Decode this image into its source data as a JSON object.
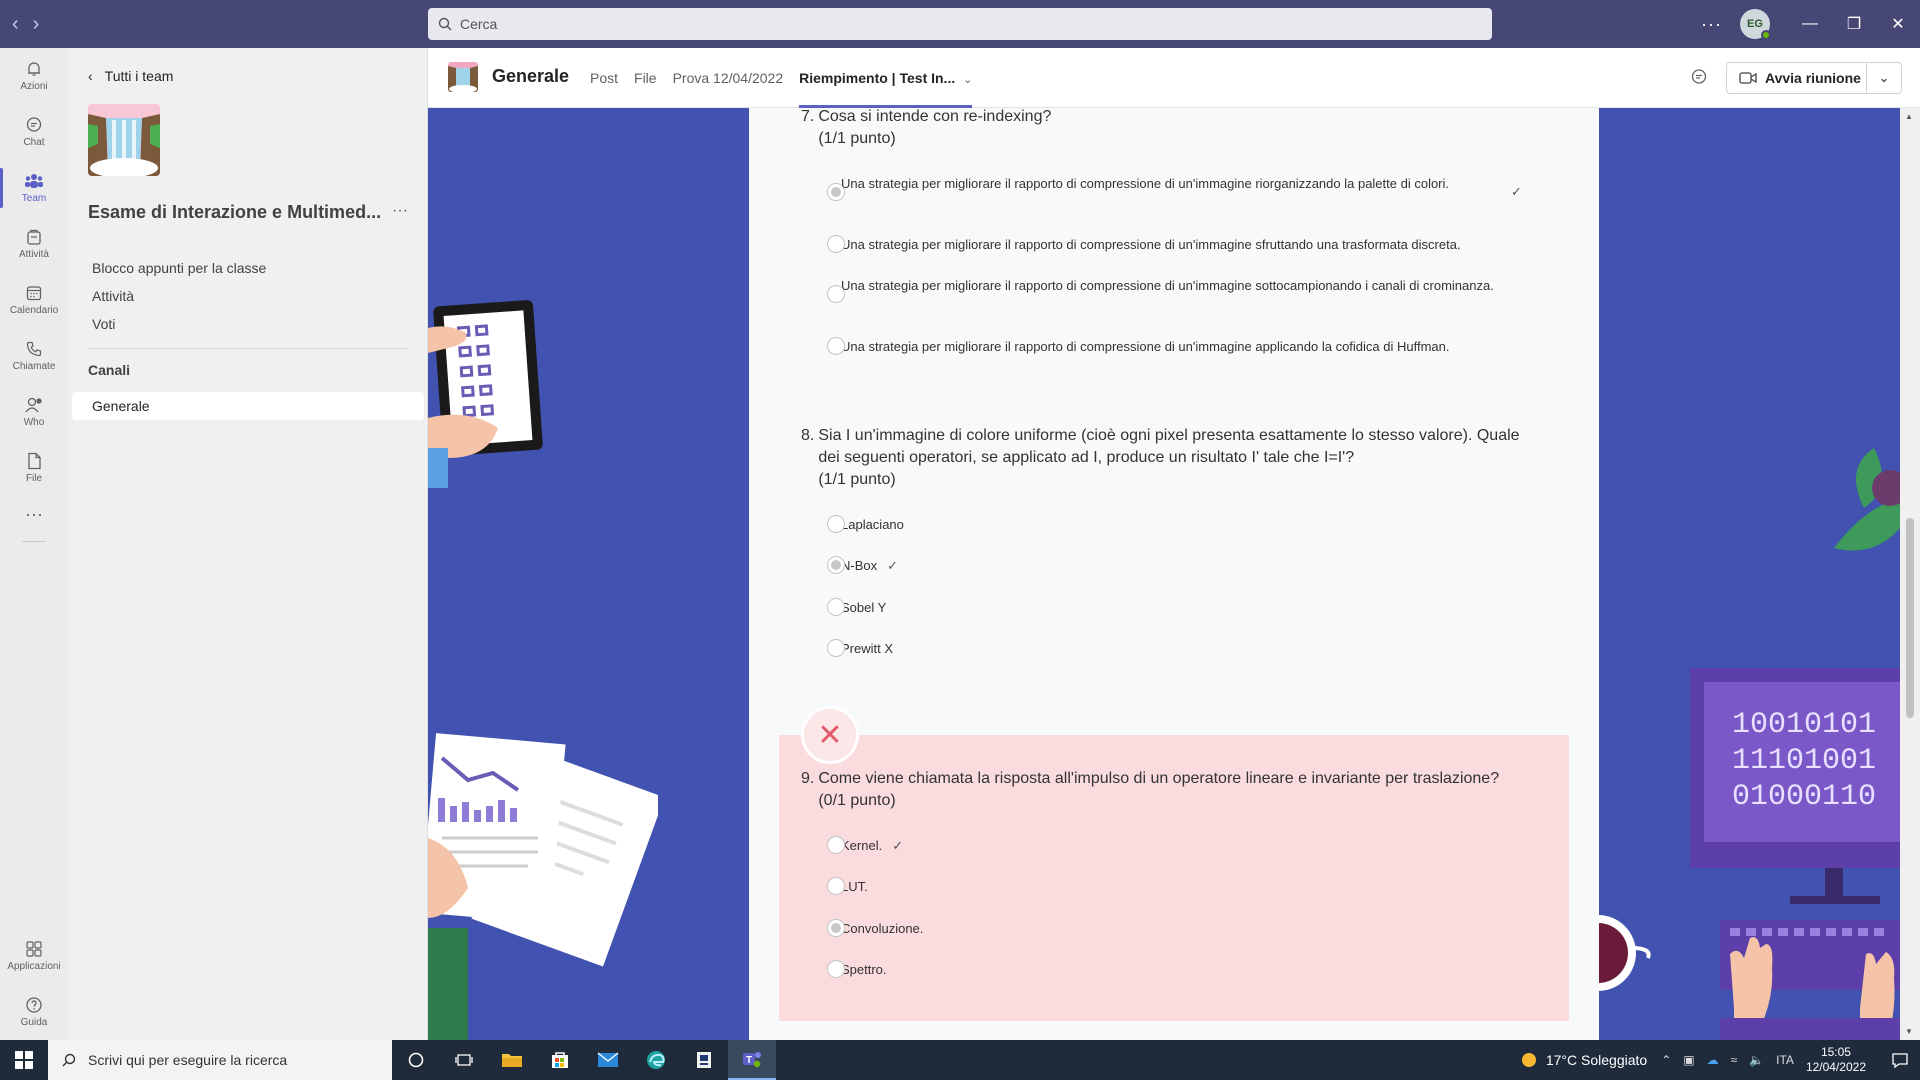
{
  "titlebar": {
    "search_placeholder": "Cerca",
    "more": "···",
    "avatar_initials": "EG"
  },
  "rail": {
    "items": [
      {
        "label": "Azioni",
        "icon": "bell-icon"
      },
      {
        "label": "Chat",
        "icon": "chat-icon"
      },
      {
        "label": "Team",
        "icon": "team-icon",
        "active": true
      },
      {
        "label": "Attività",
        "icon": "assignments-icon"
      },
      {
        "label": "Calendario",
        "icon": "calendar-icon"
      },
      {
        "label": "Chiamate",
        "icon": "phone-icon"
      },
      {
        "label": "Who",
        "icon": "who-icon"
      },
      {
        "label": "File",
        "icon": "file-icon"
      }
    ],
    "more": "···",
    "bottom": [
      {
        "label": "Applicazioni",
        "icon": "apps-icon"
      },
      {
        "label": "Guida",
        "icon": "help-icon"
      }
    ]
  },
  "team_panel": {
    "back_label": "Tutti i team",
    "team_name": "Esame di Interazione e Multimed...",
    "more": "···",
    "links": [
      "Blocco appunti per la classe",
      "Attività",
      "Voti"
    ],
    "channels_heading": "Canali",
    "channels": [
      "Generale"
    ]
  },
  "channel_header": {
    "title": "Generale",
    "tabs": [
      "Post",
      "File",
      "Prova 12/04/2022",
      "Riempimento | Test In..."
    ],
    "active_tab": 3,
    "meet_label": "Avvia riunione"
  },
  "quiz": {
    "questions": [
      {
        "number": "7.",
        "text": "Cosa si intende con re-indexing?",
        "points": "(1/1 punto)",
        "options": [
          {
            "text": "Una strategia per migliorare il rapporto di compressione di un'immagine riorganizzando la palette di colori.",
            "selected": true,
            "correct": true
          },
          {
            "text": "Una strategia per migliorare il rapporto di compressione di un'immagine sfruttando una trasformata discreta.",
            "selected": false,
            "correct": false
          },
          {
            "text": "Una strategia per migliorare il rapporto di compressione di un'immagine sottocampionando i canali di crominanza.",
            "selected": false,
            "correct": false
          },
          {
            "text": "Una strategia per migliorare il rapporto di compressione di un'immagine applicando la cofidica di Huffman.",
            "selected": false,
            "correct": false
          }
        ]
      },
      {
        "number": "8.",
        "text": "Sia I un'immagine di colore uniforme (cioè ogni pixel presenta esattamente lo stesso valore). Quale dei seguenti operatori, se applicato ad I, produce un risultato I' tale che I=I'?",
        "points": "(1/1 punto)",
        "options": [
          {
            "text": "Laplaciano",
            "selected": false,
            "correct": false
          },
          {
            "text": "N-Box",
            "selected": true,
            "correct": true
          },
          {
            "text": "Sobel Y",
            "selected": false,
            "correct": false
          },
          {
            "text": "Prewitt X",
            "selected": false,
            "correct": false
          }
        ]
      },
      {
        "number": "9.",
        "text": "Come viene chiamata la risposta all'impulso di un operatore lineare e invariante per traslazione?",
        "points": "(0/1 punto)",
        "options": [
          {
            "text": "Kernel.",
            "selected": false,
            "correct": true
          },
          {
            "text": "LUT.",
            "selected": false,
            "correct": false
          },
          {
            "text": "Convoluzione.",
            "selected": true,
            "correct": false
          },
          {
            "text": "Spettro.",
            "selected": false,
            "correct": false
          }
        ]
      }
    ],
    "wrong_mark": "✕",
    "check_mark": "✓"
  },
  "taskbar": {
    "search_placeholder": "Scrivi qui per eseguire la ricerca",
    "weather": "17°C  Soleggiato",
    "language": "ITA",
    "time": "15:05",
    "date": "12/04/2022"
  },
  "colors": {
    "titlebar": "#464775",
    "accent": "#5b5fc7",
    "content_bg": "#4152b0",
    "wrong_bg": "#fadbde"
  }
}
